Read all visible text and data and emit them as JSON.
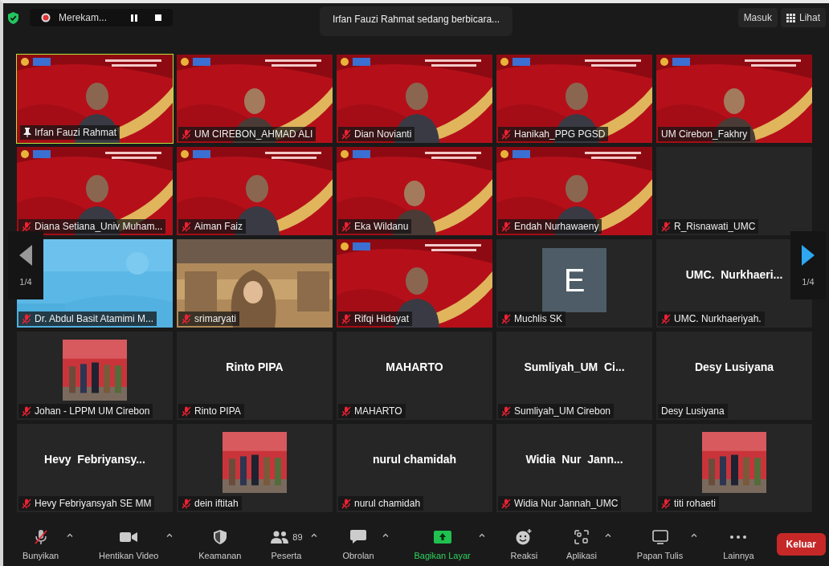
{
  "top_bar": {
    "recording": {
      "label": "Merekam..."
    },
    "speaker_notice": "Irfan Fauzi Rahmat sedang berbicara...",
    "buttons": [
      "Masuk",
      "Lihat"
    ]
  },
  "pager": {
    "left": "1/4",
    "right": "1/4"
  },
  "tiles": [
    {
      "kind": "slide",
      "name": "Irfan Fauzi Rahmat",
      "muted": false,
      "pinned": true,
      "speaking": true
    },
    {
      "kind": "slide",
      "name": "UM CIREBON_AHMAD ALI",
      "muted": true,
      "pinned": false,
      "speaking": false
    },
    {
      "kind": "slide",
      "name": "Dian Novianti",
      "muted": true,
      "pinned": false,
      "speaking": false
    },
    {
      "kind": "slide",
      "name": "Hanikah_PPG PGSD",
      "muted": true,
      "pinned": false,
      "speaking": false
    },
    {
      "kind": "slide",
      "name": "UM Cirebon_Fakhry",
      "muted": false,
      "pinned": false,
      "speaking": false
    },
    {
      "kind": "slide",
      "name": "Diana Setiana_Univ Muham...",
      "muted": true,
      "pinned": false,
      "speaking": false
    },
    {
      "kind": "slide",
      "name": "Aiman Faiz",
      "muted": true,
      "pinned": false,
      "speaking": false
    },
    {
      "kind": "slide",
      "name": "Eka Wildanu",
      "muted": true,
      "pinned": false,
      "speaking": false
    },
    {
      "kind": "slide",
      "name": "Endah Nurhawaeny",
      "muted": true,
      "pinned": false,
      "speaking": false
    },
    {
      "kind": "empty",
      "name": "R_Risnawati_UMC",
      "muted": true,
      "pinned": false,
      "speaking": false
    },
    {
      "kind": "sky",
      "name": "Dr. Abdul Basit Atamimi M...",
      "muted": true,
      "pinned": false,
      "speaking": false
    },
    {
      "kind": "banner",
      "name": "srimaryati",
      "muted": true,
      "pinned": false,
      "speaking": false
    },
    {
      "kind": "slide",
      "name": "Rifqi Hidayat",
      "muted": true,
      "pinned": false,
      "speaking": false
    },
    {
      "kind": "avatar",
      "avatar": "E",
      "name": "Muchlis SK",
      "muted": true,
      "pinned": false,
      "speaking": false
    },
    {
      "kind": "display",
      "display": "UMC.  Nurkhaeri...",
      "name": "UMC. Nurkhaeriyah.",
      "muted": true,
      "pinned": false,
      "speaking": false
    },
    {
      "name": "Johan - LPPM UM Cirebon",
      "muted": true,
      "pinned": false,
      "speaking": false
    },
    {
      "kind": "display",
      "display": "Rinto PIPA",
      "name": "Rinto PIPA",
      "muted": true,
      "pinned": false,
      "speaking": false
    },
    {
      "kind": "display",
      "display": "MAHARTO",
      "name": "MAHARTO",
      "muted": true,
      "pinned": false,
      "speaking": false
    },
    {
      "kind": "display",
      "display": "Sumliyah_UM  Ci...",
      "name": "Sumliyah_UM Cirebon",
      "muted": true,
      "pinned": false,
      "speaking": false
    },
    {
      "kind": "display",
      "display": "Desy Lusiyana",
      "name": "Desy Lusiyana",
      "muted": false,
      "pinned": false,
      "speaking": false
    },
    {
      "kind": "display",
      "display": "Hevy  Febriyansy...",
      "name": "Hevy Febriyansyah SE MM",
      "muted": true,
      "pinned": false,
      "speaking": false
    },
    {
      "name": "dein iftitah",
      "muted": true,
      "pinned": false,
      "speaking": false
    },
    {
      "kind": "display",
      "display": "nurul chamidah",
      "name": "nurul chamidah",
      "muted": true,
      "pinned": false,
      "speaking": false
    },
    {
      "kind": "display",
      "display": "Widia  Nur  Jann...",
      "name": "Widia Nur Jannah_UMC",
      "muted": true,
      "pinned": false,
      "speaking": false
    },
    {
      "name": "titi rohaeti",
      "muted": true,
      "pinned": false,
      "speaking": false
    }
  ],
  "toolbar": [
    {
      "kind": "mic",
      "label": "Bunyikan",
      "chevron": true,
      "active": false
    },
    {
      "kind": "video",
      "label": "Hentikan Video",
      "chevron": true,
      "active": false
    },
    {
      "kind": "shield",
      "label": "Keamanan",
      "chevron": false,
      "active": false
    },
    {
      "kind": "people",
      "label": "Peserta",
      "count": "89",
      "chevron": true,
      "active": false
    },
    {
      "kind": "chat",
      "label": "Obrolan",
      "chevron": true,
      "active": false
    },
    {
      "kind": "share",
      "label": "Bagikan Layar",
      "chevron": true,
      "active": true
    },
    {
      "kind": "reaction",
      "label": "Reaksi",
      "chevron": false,
      "active": false
    },
    {
      "kind": "apps",
      "label": "Aplikasi",
      "chevron": true,
      "active": false
    },
    {
      "kind": "board",
      "label": "Papan Tulis",
      "chevron": true,
      "active": false
    },
    {
      "kind": "more",
      "label": "Lainnya",
      "chevron": false,
      "active": false
    }
  ],
  "leave_button": "Keluar"
}
